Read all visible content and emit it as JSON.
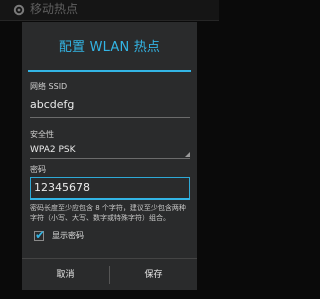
{
  "topbar": {
    "title": "移动热点",
    "icon": "settings-icon"
  },
  "dialog": {
    "title": "配置 WLAN 热点",
    "ssid_label": "网络 SSID",
    "ssid_value": "abcdefg",
    "security_label": "安全性",
    "security_value": "WPA2 PSK",
    "password_label": "密码",
    "password_value": "12345678",
    "password_hint": "密码长度至少应包含 8 个字符，建议至少包含两种字符（小写、大写、数字或特殊字符）组合。",
    "show_password_label": "显示密码",
    "show_password_checked": true,
    "cancel_label": "取消",
    "save_label": "保存"
  },
  "colors": {
    "accent": "#33b5e5",
    "dialog_bg": "#2a2b2c",
    "page_bg": "#0a0a0a"
  }
}
